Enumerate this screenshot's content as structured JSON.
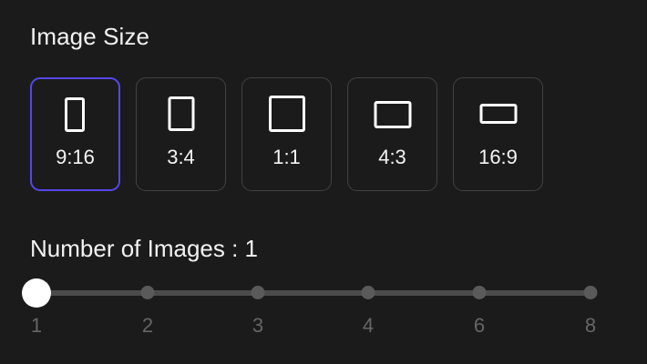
{
  "image_size": {
    "title": "Image Size",
    "options": [
      {
        "label": "9:16",
        "selected": true
      },
      {
        "label": "3:4",
        "selected": false
      },
      {
        "label": "1:1",
        "selected": false
      },
      {
        "label": "4:3",
        "selected": false
      },
      {
        "label": "16:9",
        "selected": false
      }
    ]
  },
  "number_of_images": {
    "title": "Number of Images : 1",
    "value": 1,
    "steps": [
      "1",
      "2",
      "3",
      "4",
      "6",
      "8"
    ]
  },
  "colors": {
    "background": "#1b1b1b",
    "selected_border": "#5548e8",
    "card_border": "#424242",
    "slider_track": "#4b4b4b",
    "slider_thumb": "#ffffff",
    "step_label": "#666666"
  }
}
